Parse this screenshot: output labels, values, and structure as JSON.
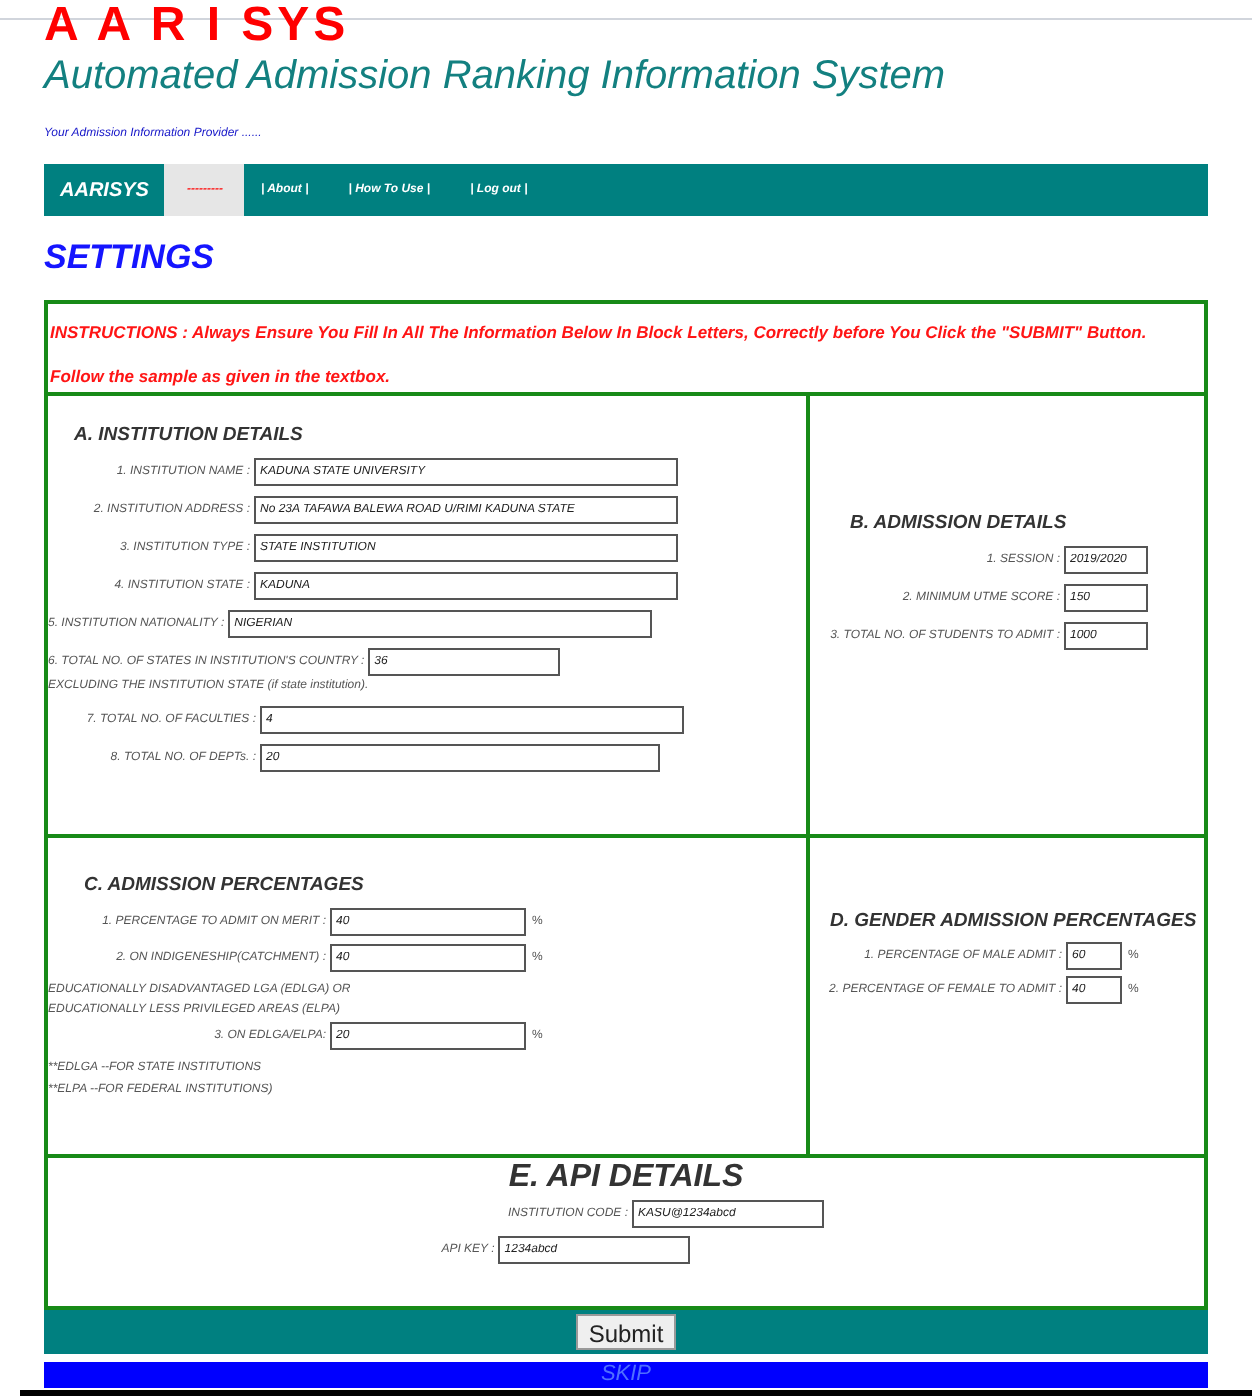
{
  "header": {
    "logo": "A A R I SYS",
    "title": "Automated Admission Ranking Information System",
    "tagline": "Your Admission Information Provider ......"
  },
  "nav_brand": "AARISYS",
  "nav": [
    {
      "label": "---------",
      "kind": "tab",
      "selected": true
    },
    {
      "label": "| About |",
      "kind": "tab",
      "selected": false
    },
    {
      "label": "| How To Use |",
      "kind": "tab",
      "selected": false
    },
    {
      "label": "| Log out |",
      "kind": "tab",
      "selected": false
    }
  ],
  "page_title": "SETTINGS",
  "instructions": "INSTRUCTIONS : Always Ensure You Fill In All The Information Below In Block Letters, Correctly before You Click the \"SUBMIT\" Button. Follow the sample as given in the textbox.",
  "sections": [
    {
      "heading": "A. INSTITUTION DETAILS",
      "items": [
        {
          "kind": "field",
          "label": "1. INSTITUTION NAME :",
          "value": "KADUNA STATE UNIVERSITY"
        },
        {
          "kind": "field",
          "label": "2. INSTITUTION ADDRESS :",
          "value": "No 23A TAFAWA BALEWA ROAD U/RIMI KADUNA STATE"
        },
        {
          "kind": "field",
          "label": "3. INSTITUTION TYPE :",
          "value": "STATE INSTITUTION"
        },
        {
          "kind": "field",
          "label": "4. INSTITUTION STATE :",
          "value": "KADUNA"
        },
        {
          "kind": "field",
          "label": "5. INSTITUTION NATIONALITY :",
          "value": "NIGERIAN"
        },
        {
          "kind": "field",
          "label": "6. TOTAL NO. OF STATES IN INSTITUTION'S COUNTRY :",
          "value": "36"
        },
        {
          "kind": "note",
          "text": "EXCLUDING THE INSTITUTION STATE (if state institution)."
        },
        {
          "kind": "field",
          "label": "7. TOTAL NO. OF FACULTIES :",
          "value": "4"
        },
        {
          "kind": "field",
          "label": "8. TOTAL NO. OF DEPTs. :",
          "value": "20"
        }
      ]
    },
    {
      "heading": "B. ADMISSION DETAILS",
      "items": [
        {
          "kind": "field",
          "label": "1. SESSION :",
          "value": "2019/2020"
        },
        {
          "kind": "field",
          "label": "2. MINIMUM UTME SCORE :",
          "value": "150"
        },
        {
          "kind": "field",
          "label": "3. TOTAL NO. OF STUDENTS TO ADMIT :",
          "value": "1000"
        }
      ]
    },
    {
      "heading": "C. ADMISSION PERCENTAGES",
      "items": [
        {
          "kind": "field",
          "label": "1. PERCENTAGE TO ADMIT ON MERIT :",
          "value": "40",
          "suffix": "%"
        },
        {
          "kind": "field",
          "label": "2. ON INDIGENESHIP(CATCHMENT) :",
          "value": "40",
          "suffix": "%"
        },
        {
          "kind": "note",
          "text": "EDUCATIONALLY DISADVANTAGED LGA (EDLGA) OR EDUCATIONALLY LESS PRIVILEGED AREAS (ELPA)"
        },
        {
          "kind": "field",
          "label": "3. ON EDLGA/ELPA:",
          "value": "20",
          "suffix": "%"
        },
        {
          "kind": "note",
          "text": "**EDLGA --FOR STATE INSTITUTIONS"
        },
        {
          "kind": "note",
          "text": "**ELPA --FOR FEDERAL INSTITUTIONS)"
        }
      ]
    },
    {
      "heading": "D. GENDER ADMISSION PERCENTAGES",
      "items": [
        {
          "kind": "field",
          "label": "1. PERCENTAGE OF MALE ADMIT :",
          "value": "60",
          "suffix": "%"
        },
        {
          "kind": "field",
          "label": "2. PERCENTAGE OF FEMALE TO ADMIT :",
          "value": "40",
          "suffix": "%"
        }
      ]
    },
    {
      "heading": "E. API DETAILS",
      "items": [
        {
          "kind": "field",
          "label": "INSTITUTION CODE :",
          "value": "KASU@1234abcd"
        },
        {
          "kind": "field",
          "label": "API KEY :",
          "value": "1234abcd"
        }
      ]
    }
  ],
  "submit": "Submit",
  "skip": "SKIP"
}
